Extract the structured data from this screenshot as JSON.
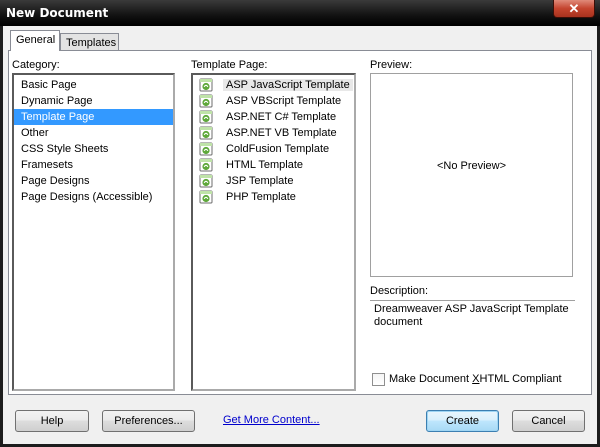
{
  "window": {
    "title": "New Document",
    "close_glyph": "✕"
  },
  "tabs": [
    {
      "label": "General",
      "active": true
    },
    {
      "label": "Templates",
      "active": false
    }
  ],
  "category": {
    "label": "Category:",
    "items": [
      {
        "label": "Basic Page"
      },
      {
        "label": "Dynamic Page"
      },
      {
        "label": "Template Page",
        "selected": true
      },
      {
        "label": "Other"
      },
      {
        "label": "CSS Style Sheets"
      },
      {
        "label": "Framesets"
      },
      {
        "label": "Page Designs"
      },
      {
        "label": "Page Designs (Accessible)"
      }
    ]
  },
  "template_page": {
    "label": "Template Page:",
    "items": [
      {
        "label": "ASP JavaScript Template",
        "selected": true,
        "icon": "template-icon"
      },
      {
        "label": "ASP VBScript Template",
        "icon": "template-icon"
      },
      {
        "label": "ASP.NET C# Template",
        "icon": "template-icon"
      },
      {
        "label": "ASP.NET VB Template",
        "icon": "template-icon"
      },
      {
        "label": "ColdFusion Template",
        "icon": "template-icon"
      },
      {
        "label": "HTML Template",
        "icon": "template-icon"
      },
      {
        "label": "JSP Template",
        "icon": "template-icon"
      },
      {
        "label": "PHP Template",
        "icon": "template-icon"
      }
    ]
  },
  "preview": {
    "label": "Preview:",
    "text": "<No Preview>"
  },
  "description": {
    "label": "Description:",
    "text": "Dreamweaver ASP JavaScript Template document"
  },
  "xhtml": {
    "label_pre": "Make Document ",
    "label_accel": "X",
    "label_post": "HTML Compliant",
    "checked": false
  },
  "buttons": {
    "help": "Help",
    "preferences": "Preferences...",
    "more_content": "Get More Content...",
    "create": "Create",
    "cancel": "Cancel"
  },
  "colors": {
    "selection": "#3399ff",
    "link": "#0000cc",
    "icon_green": "#5ea83a"
  }
}
